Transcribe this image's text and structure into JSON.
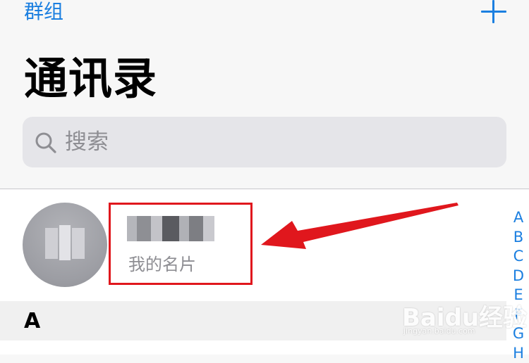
{
  "nav": {
    "groups_label": "群组",
    "add_icon": "plus-icon"
  },
  "title": "通讯录",
  "search": {
    "placeholder": "搜索",
    "icon": "search-icon"
  },
  "my_card": {
    "name_obscured": true,
    "subtitle": "我的名片"
  },
  "section": {
    "letter": "A"
  },
  "index": [
    "A",
    "B",
    "C",
    "D",
    "E",
    "F",
    "G",
    "H"
  ],
  "watermark": {
    "text": "Baidu经验",
    "sub": "jingyan.baidu.com"
  },
  "colors": {
    "accent": "#1b7fe0",
    "annotation": "#e0171d"
  }
}
